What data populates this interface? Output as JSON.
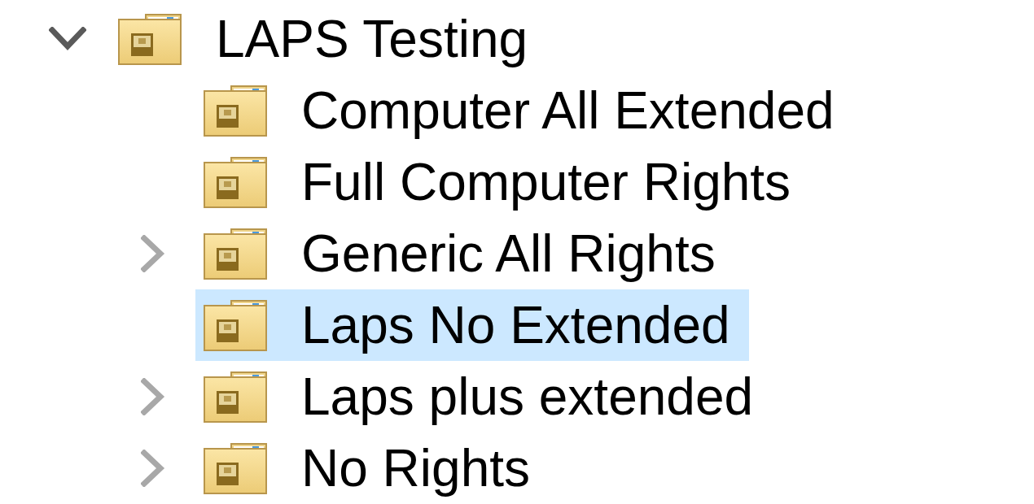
{
  "tree": [
    {
      "label": "LAPS Testing",
      "has_children": true,
      "expanded": true,
      "selected": false,
      "children": [
        {
          "label": "Computer All Extended",
          "has_children": false,
          "selected": false
        },
        {
          "label": "Full Computer Rights",
          "has_children": false,
          "selected": false
        },
        {
          "label": "Generic All Rights",
          "has_children": true,
          "expanded": false,
          "selected": false
        },
        {
          "label": "Laps No Extended",
          "has_children": false,
          "selected": true
        },
        {
          "label": "Laps plus extended",
          "has_children": true,
          "expanded": false,
          "selected": false
        },
        {
          "label": "No Rights",
          "has_children": true,
          "expanded": false,
          "selected": false
        }
      ]
    }
  ]
}
